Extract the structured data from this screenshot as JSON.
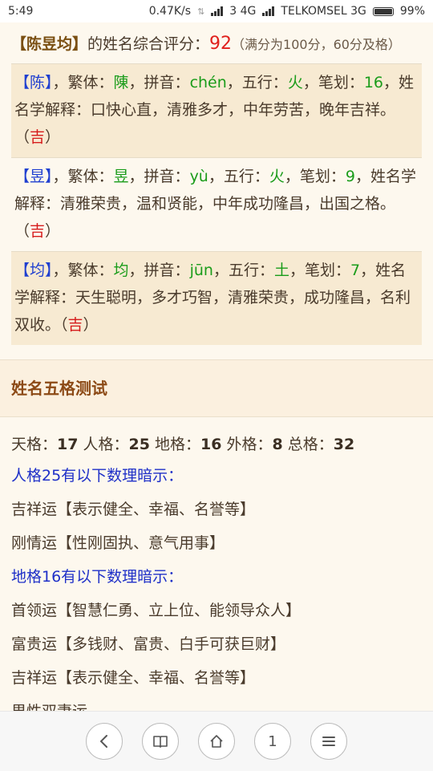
{
  "status": {
    "time": "5:49",
    "speed": "0.47K/s",
    "sim1": "3 4G",
    "carrier": "TELKOMSEL 3G",
    "battery": "99%"
  },
  "score": {
    "name": "【陈昱均】",
    "label": "的姓名综合评分：",
    "value": "92",
    "note": "（满分为100分，60分及格）"
  },
  "chars": [
    {
      "char_bracket": "【陈】",
      "trad_label": "，繁体：",
      "trad": "陳",
      "pinyin_label": "，拼音：",
      "pinyin": "chén",
      "wuxing_label": "，五行：",
      "wuxing": "火",
      "strokes_label": "，笔划：",
      "strokes": "16",
      "meaning": "，姓名学解释：口快心直，清雅多才，中年劳苦，晚年吉祥。（",
      "luck": "吉",
      "close": "）"
    },
    {
      "char_bracket": "【昱】",
      "trad_label": "，繁体：",
      "trad": "昱",
      "pinyin_label": "，拼音：",
      "pinyin": "yù",
      "wuxing_label": "，五行：",
      "wuxing": "火",
      "strokes_label": "，笔划：",
      "strokes": "9",
      "meaning": "，姓名学解释：清雅荣贵，温和贤能，中年成功隆昌，出国之格。（",
      "luck": "吉",
      "close": "）"
    },
    {
      "char_bracket": "【均】",
      "trad_label": "，繁体：",
      "trad": "均",
      "pinyin_label": "，拼音：",
      "pinyin": "jūn",
      "wuxing_label": "，五行：",
      "wuxing": "土",
      "strokes_label": "，笔划：",
      "strokes": "7",
      "meaning": "，姓名学解释：天生聪明，多才巧智，清雅荣贵，成功隆昌，名利双收。（",
      "luck": "吉",
      "close": "）"
    }
  ],
  "section": {
    "title": "姓名五格测试"
  },
  "wuge": {
    "tian_label": "天格：",
    "tian": "17",
    "ren_label": " 人格：",
    "ren": "25",
    "di_label": " 地格：",
    "di": "16",
    "wai_label": " 外格：",
    "wai": "8",
    "zong_label": " 总格：",
    "zong": "32"
  },
  "lines": [
    {
      "text": "人格25有以下数理暗示：",
      "hint": true
    },
    {
      "text": "吉祥运【表示健全、幸福、名誉等】",
      "hint": false
    },
    {
      "text": "刚情运【性刚固执、意气用事】",
      "hint": false
    },
    {
      "text": "地格16有以下数理暗示：",
      "hint": true
    },
    {
      "text": "首领运【智慧仁勇、立上位、能领导众人】",
      "hint": false
    },
    {
      "text": "富贵运【多钱财、富贵、白手可获巨财】",
      "hint": false
    },
    {
      "text": "吉祥运【表示健全、幸福、名誉等】",
      "hint": false
    },
    {
      "text": "男性双妻运",
      "hint": false
    }
  ],
  "nav": {
    "back_icon": "chevron-left-icon",
    "bookmarks_icon": "book-icon",
    "home_icon": "home-icon",
    "tab_count": "1",
    "menu_icon": "menu-icon"
  },
  "colors": {
    "name_highlight": "#1f3fd0",
    "value_green": "#1a9c1a",
    "luck_red": "#d61c1c",
    "score_red": "#e0201c",
    "hint_blue": "#1f30c8",
    "section_title": "#8c4a16"
  }
}
